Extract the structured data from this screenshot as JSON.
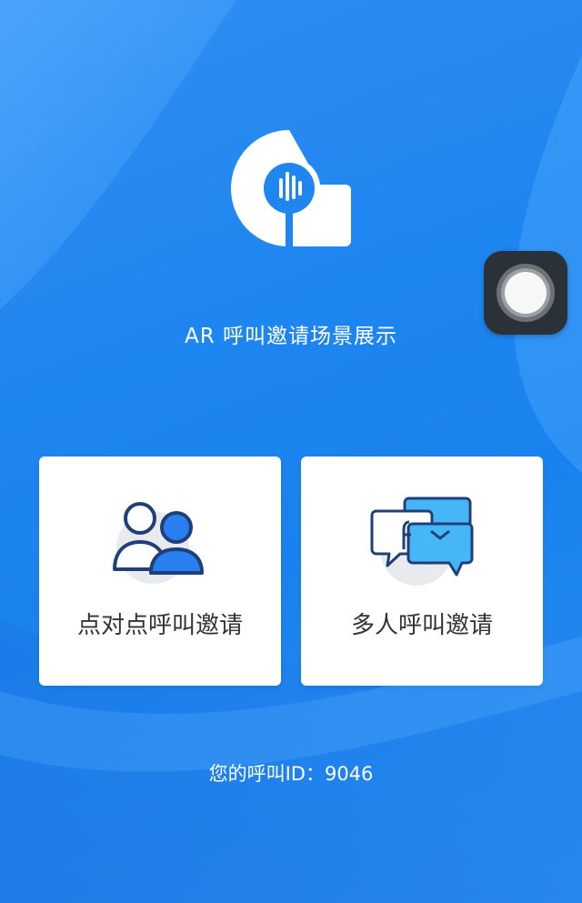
{
  "app": {
    "title": "AR 呼叫邀请场景展示"
  },
  "options": [
    {
      "label": "点对点呼叫邀请",
      "icon": "two-users-icon"
    },
    {
      "label": "多人呼叫邀请",
      "icon": "chat-bubbles-icon"
    }
  ],
  "footer": {
    "caller_id_label": "您的呼叫ID：9046"
  },
  "colors": {
    "background": "#1f86f0",
    "card": "#ffffff",
    "icon_dark": "#1f3f7a",
    "icon_blue": "#2a7ff0",
    "icon_light_blue": "#46b6f6",
    "icon_circle_bg": "#e8eaee"
  }
}
